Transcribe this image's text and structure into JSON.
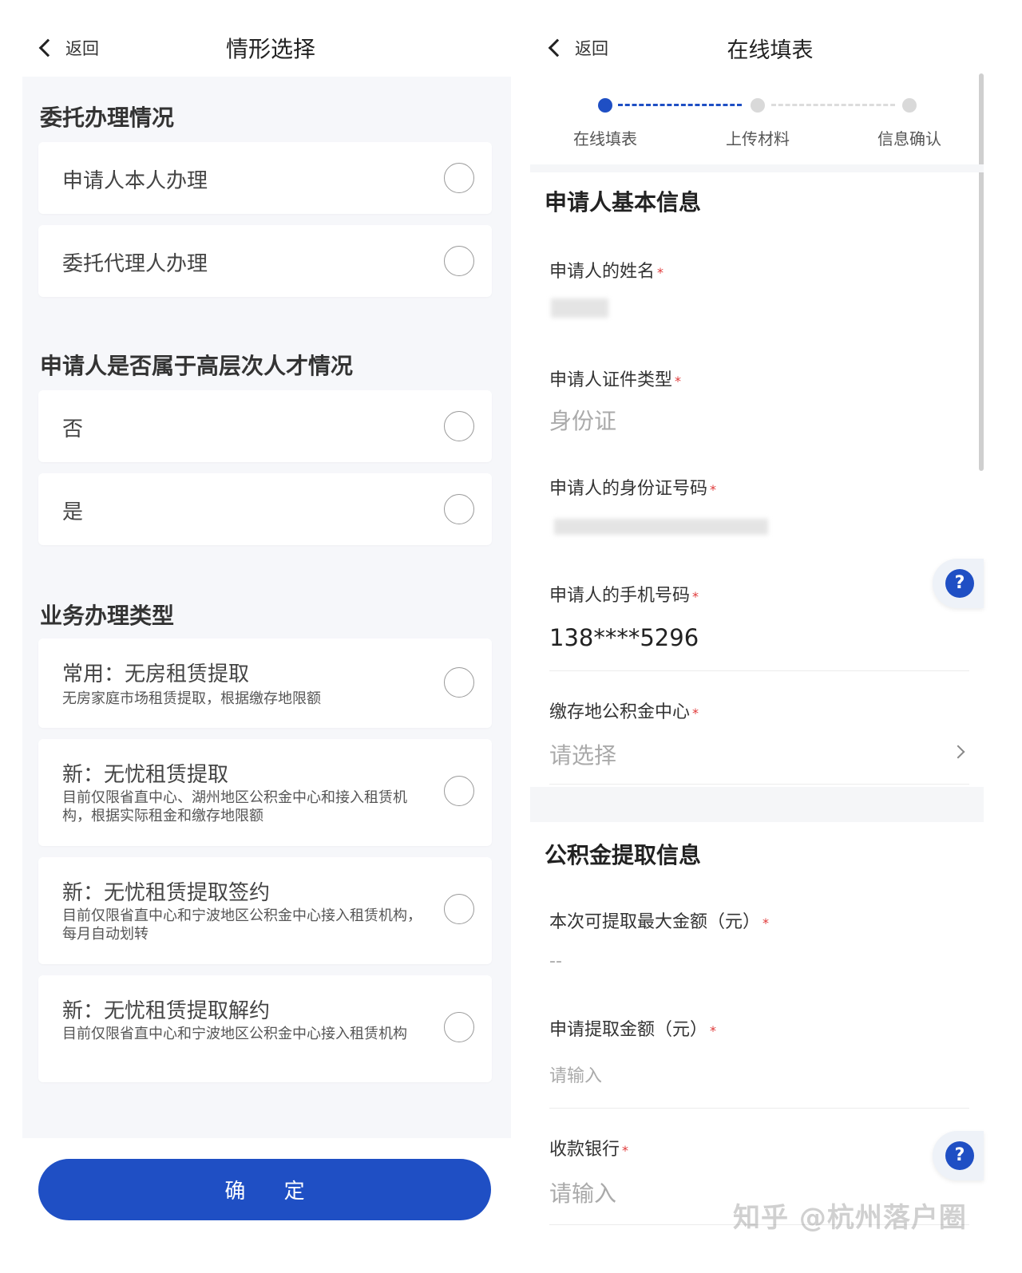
{
  "left": {
    "back_label": "返回",
    "title": "情形选择",
    "sections": [
      {
        "title": "委托办理情况",
        "options": [
          {
            "label": "申请人本人办理"
          },
          {
            "label": "委托代理人办理"
          }
        ]
      },
      {
        "title": "申请人是否属于高层次人才情况",
        "options": [
          {
            "label": "否"
          },
          {
            "label": "是"
          }
        ]
      },
      {
        "title": "业务办理类型",
        "options": [
          {
            "label": "常用：无房租赁提取",
            "desc": "无房家庭市场租赁提取，根据缴存地限额"
          },
          {
            "label": "新：无忧租赁提取",
            "desc": "目前仅限省直中心、湖州地区公积金中心和接入租赁机构，根据实际租金和缴存地限额"
          },
          {
            "label": "新：无忧租赁提取签约",
            "desc": "目前仅限省直中心和宁波地区公积金中心接入租赁机构，每月自动划转"
          },
          {
            "label": "新：无忧租赁提取解约",
            "desc": "目前仅限省直中心和宁波地区公积金中心接入租赁机构"
          }
        ]
      }
    ],
    "confirm_label": "确 定"
  },
  "right": {
    "back_label": "返回",
    "title": "在线填表",
    "steps": [
      "在线填表",
      "上传材料",
      "信息确认"
    ],
    "current_step": 1,
    "basic_info": {
      "title": "申请人基本信息",
      "name_label": "申请人的姓名",
      "id_type_label": "申请人证件类型",
      "id_type_value": "身份证",
      "id_number_label": "申请人的身份证号码",
      "phone_label": "申请人的手机号码",
      "phone_value": "138****5296",
      "center_label": "缴存地公积金中心",
      "center_placeholder": "请选择"
    },
    "withdraw_info": {
      "title": "公积金提取信息",
      "max_label": "本次可提取最大金额（元）",
      "max_value": "--",
      "apply_label": "申请提取金额（元）",
      "apply_placeholder": "请输入",
      "bank_label": "收款银行",
      "bank_placeholder": "请输入"
    },
    "required_mark": "*",
    "help_symbol": "?"
  },
  "watermark": "知乎 @杭州落户圈",
  "colors": {
    "accent": "#1f4fc4",
    "required": "#e03a3a",
    "panel_bg": "#f6f7fa"
  }
}
